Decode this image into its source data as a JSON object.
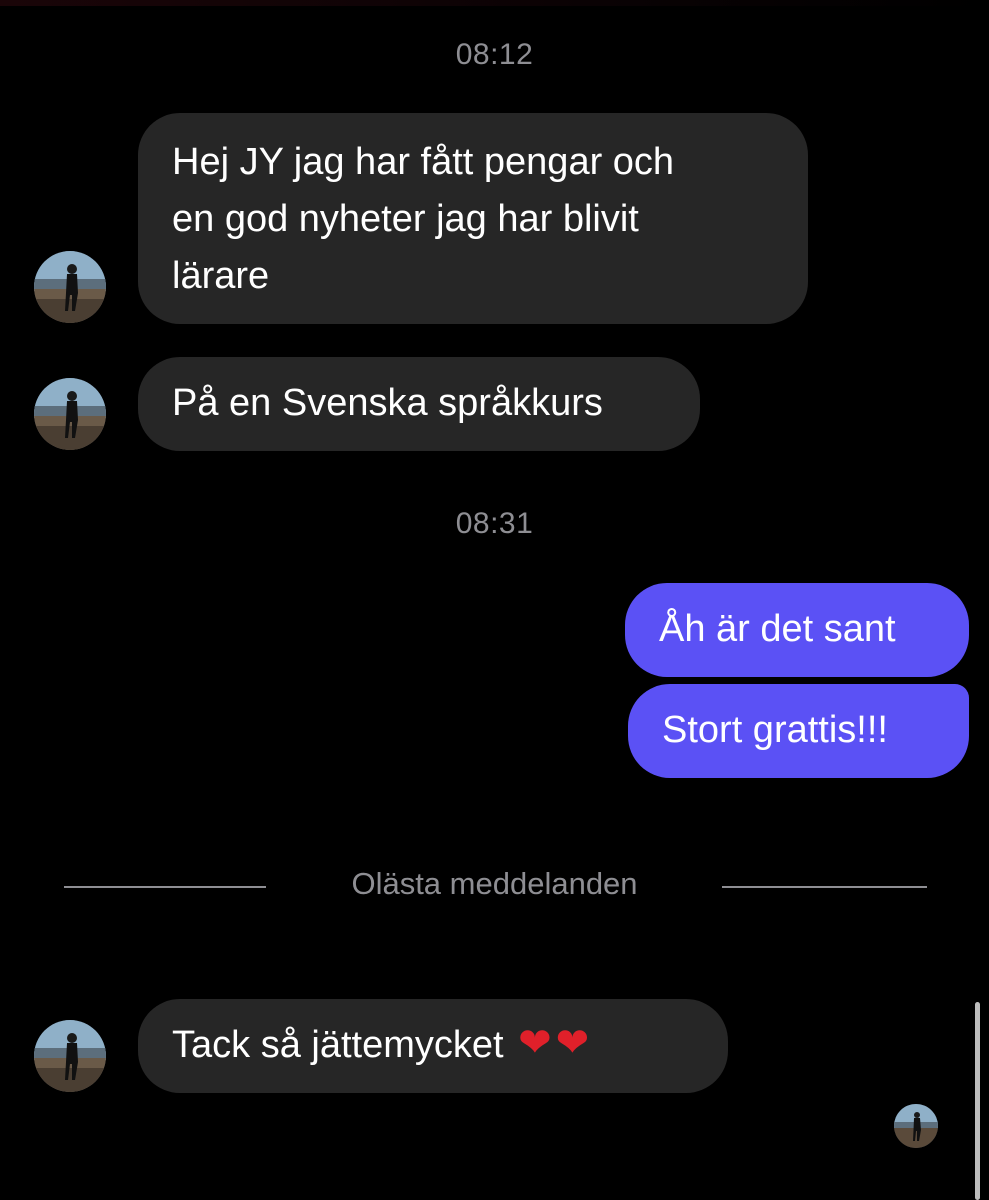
{
  "colors": {
    "background": "#000000",
    "incoming_bubble": "#262626",
    "outgoing_bubble": "#5b51f5",
    "meta_text": "#8e8e93",
    "heart": "#e0202a"
  },
  "thread": {
    "timestamp_1": "08:12",
    "timestamp_2": "08:31",
    "messages": [
      {
        "direction": "incoming",
        "lines": [
          "Hej JY jag har fått pengar och",
          "en god nyheter jag har blivit",
          "lärare"
        ]
      },
      {
        "direction": "incoming",
        "text": "På en Svenska språkkurs"
      },
      {
        "direction": "outgoing",
        "text": "Åh är det sant"
      },
      {
        "direction": "outgoing",
        "text": "Stort grattis!!!"
      },
      {
        "direction": "incoming",
        "text": "Tack så jättemycket",
        "emoji": [
          "❤",
          "❤"
        ]
      }
    ],
    "unread_divider": "Olästa meddelanden"
  },
  "icons": {
    "avatar": "profile-photo-avatar",
    "heart": "red-heart-emoji",
    "seen_indicator": "seen-avatar-icon"
  }
}
